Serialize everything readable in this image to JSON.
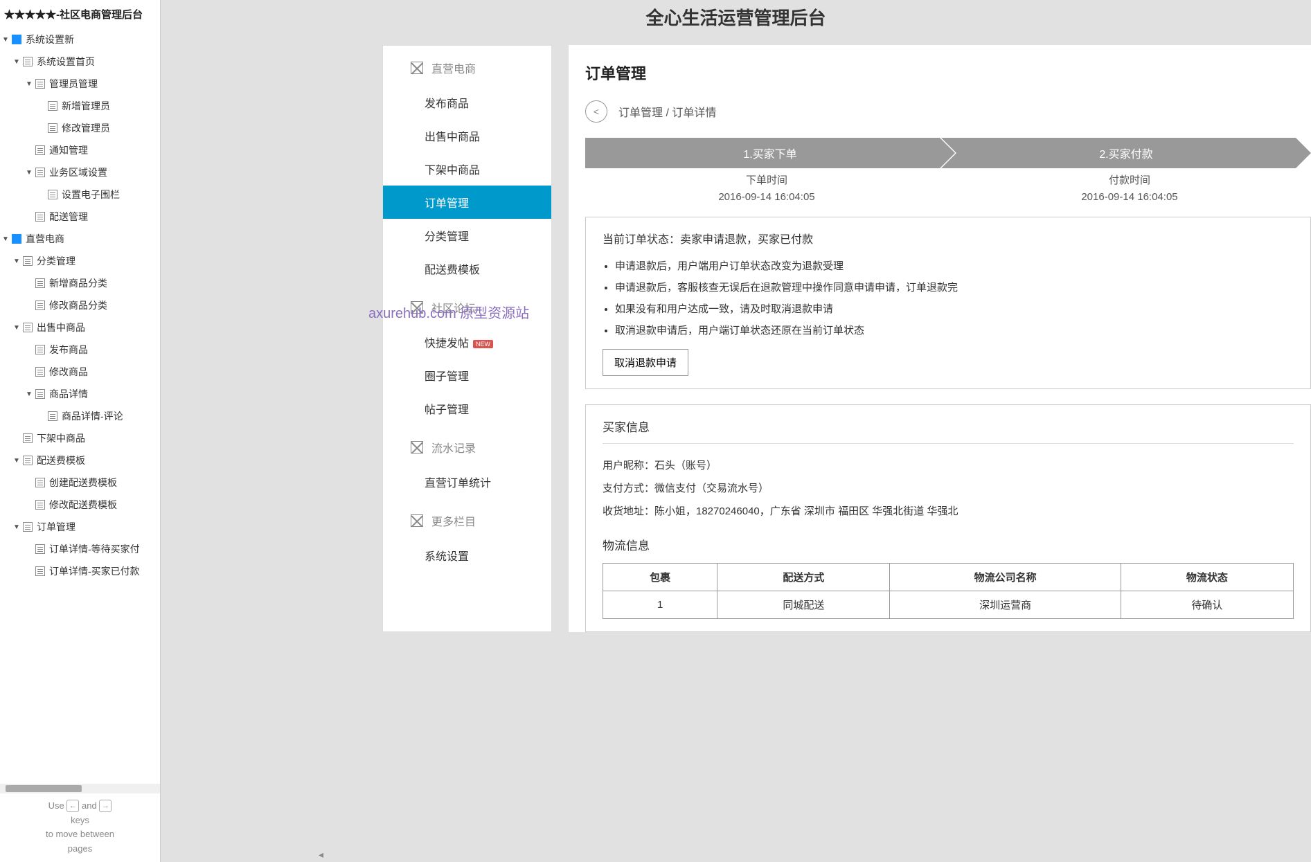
{
  "sidebar": {
    "title": "★★★★★-社区电商管理后台",
    "tree": [
      {
        "lvl": 0,
        "caret": "▼",
        "icon": "folder",
        "label": "系统设置新"
      },
      {
        "lvl": 1,
        "caret": "▼",
        "icon": "page",
        "label": "系统设置首页"
      },
      {
        "lvl": 2,
        "caret": "▼",
        "icon": "page",
        "label": "管理员管理"
      },
      {
        "lvl": 3,
        "caret": "",
        "icon": "page",
        "label": "新增管理员"
      },
      {
        "lvl": 3,
        "caret": "",
        "icon": "page",
        "label": "修改管理员"
      },
      {
        "lvl": 2,
        "caret": "",
        "icon": "page",
        "label": "通知管理"
      },
      {
        "lvl": 2,
        "caret": "▼",
        "icon": "page",
        "label": "业务区域设置"
      },
      {
        "lvl": 3,
        "caret": "",
        "icon": "page",
        "label": "设置电子围栏"
      },
      {
        "lvl": 2,
        "caret": "",
        "icon": "page",
        "label": "配送管理"
      },
      {
        "lvl": 0,
        "caret": "▼",
        "icon": "folder",
        "label": "直营电商"
      },
      {
        "lvl": 1,
        "caret": "▼",
        "icon": "page",
        "label": "分类管理"
      },
      {
        "lvl": 2,
        "caret": "",
        "icon": "page",
        "label": "新增商品分类"
      },
      {
        "lvl": 2,
        "caret": "",
        "icon": "page",
        "label": "修改商品分类"
      },
      {
        "lvl": 1,
        "caret": "▼",
        "icon": "page",
        "label": "出售中商品"
      },
      {
        "lvl": 2,
        "caret": "",
        "icon": "page",
        "label": "发布商品"
      },
      {
        "lvl": 2,
        "caret": "",
        "icon": "page",
        "label": "修改商品"
      },
      {
        "lvl": 2,
        "caret": "▼",
        "icon": "page",
        "label": "商品详情"
      },
      {
        "lvl": 3,
        "caret": "",
        "icon": "page",
        "label": "商品详情-评论"
      },
      {
        "lvl": 1,
        "caret": "",
        "icon": "page",
        "label": "下架中商品"
      },
      {
        "lvl": 1,
        "caret": "▼",
        "icon": "page",
        "label": "配送费模板"
      },
      {
        "lvl": 2,
        "caret": "",
        "icon": "page",
        "label": "创建配送费模板"
      },
      {
        "lvl": 2,
        "caret": "",
        "icon": "page",
        "label": "修改配送费模板"
      },
      {
        "lvl": 1,
        "caret": "▼",
        "icon": "page",
        "label": "订单管理"
      },
      {
        "lvl": 2,
        "caret": "",
        "icon": "page",
        "label": "订单详情-等待买家付"
      },
      {
        "lvl": 2,
        "caret": "",
        "icon": "page",
        "label": "订单详情-买家已付款"
      }
    ],
    "hint": {
      "use": "Use",
      "and": "and",
      "keys": "keys",
      "move": "to move between",
      "pages": "pages",
      "left": "←",
      "right": "→"
    }
  },
  "header": {
    "title": "全心生活运营管理后台"
  },
  "nav": {
    "groups": [
      {
        "head": "直营电商",
        "items": [
          {
            "label": "发布商品",
            "active": false
          },
          {
            "label": "出售中商品",
            "active": false
          },
          {
            "label": "下架中商品",
            "active": false
          },
          {
            "label": "订单管理",
            "active": true
          },
          {
            "label": "分类管理",
            "active": false
          },
          {
            "label": "配送费模板",
            "active": false
          }
        ]
      },
      {
        "head": "社区论坛",
        "items": [
          {
            "label": "快捷发帖",
            "active": false,
            "badge": "NEW"
          },
          {
            "label": "圈子管理",
            "active": false
          },
          {
            "label": "帖子管理",
            "active": false
          }
        ]
      },
      {
        "head": "流水记录",
        "items": [
          {
            "label": "直营订单统计",
            "active": false
          }
        ]
      },
      {
        "head": "更多栏目",
        "items": [
          {
            "label": "系统设置",
            "active": false
          }
        ]
      }
    ]
  },
  "content": {
    "page_title": "订单管理",
    "back_icon": "<",
    "breadcrumb": "订单管理 / 订单详情",
    "steps": [
      {
        "label": "1.买家下单",
        "meta_label": "下单时间",
        "meta_value": "2016-09-14 16:04:05"
      },
      {
        "label": "2.买家付款",
        "meta_label": "付款时间",
        "meta_value": "2016-09-14 16:04:05"
      }
    ],
    "status": {
      "line": "当前订单状态：卖家申请退款，买家已付款",
      "bullets": [
        "申请退款后，用户端用户订单状态改变为退款受理",
        "申请退款后，客服核查无误后在退款管理中操作同意申请申请，订单退款完",
        "如果没有和用户达成一致，请及时取消退款申请",
        "取消退款申请后，用户端订单状态还原在当前订单状态"
      ],
      "action": "取消退款申请"
    },
    "buyer": {
      "head": "买家信息",
      "lines": [
        "用户昵称：石头（账号）",
        "支付方式：微信支付（交易流水号）",
        "收货地址：陈小姐，18270246040，广东省 深圳市 福田区 华强北街道 华强北"
      ]
    },
    "logistics": {
      "head": "物流信息",
      "cols": [
        "包裹",
        "配送方式",
        "物流公司名称",
        "物流状态"
      ],
      "rows": [
        [
          "1",
          "同城配送",
          "深圳运营商",
          "待确认"
        ]
      ]
    }
  },
  "watermark": "axurehub.com 原型资源站"
}
